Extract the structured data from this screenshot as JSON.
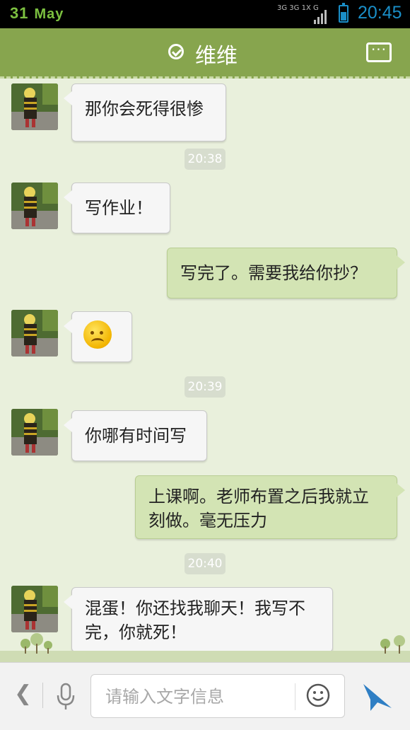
{
  "status_bar": {
    "date_day": "31",
    "date_month": "May",
    "network_labels": "3G 3G 1X G",
    "time": "20:45",
    "battery_level": 0.55,
    "colors": {
      "date": "#7cc040",
      "time": "#1a8ec7"
    }
  },
  "header": {
    "title": "维维",
    "verified_icon": "check-circle-icon",
    "menu_icon": "more-options-icon",
    "color": "#87a54e"
  },
  "messages": [
    {
      "type": "in",
      "text": "那你会死得很惨"
    },
    {
      "type": "time",
      "text": "20:38"
    },
    {
      "type": "in",
      "text": "写作业！"
    },
    {
      "type": "out",
      "text": "写完了。需要我给你抄？"
    },
    {
      "type": "in",
      "emoji": "frowning-face-icon"
    },
    {
      "type": "time",
      "text": "20:39"
    },
    {
      "type": "in",
      "text": "你哪有时间写"
    },
    {
      "type": "out",
      "text": "上课啊。老师布置之后我就立刻做。毫无压力"
    },
    {
      "type": "time",
      "text": "20:40"
    },
    {
      "type": "in",
      "text": "混蛋！你还找我聊天！我写不完，你就死！"
    }
  ],
  "input_bar": {
    "placeholder": "请输入文字信息",
    "back_icon": "chevron-left-icon",
    "mic_icon": "microphone-icon",
    "emoji_icon": "smiley-icon",
    "send_icon": "send-icon"
  }
}
